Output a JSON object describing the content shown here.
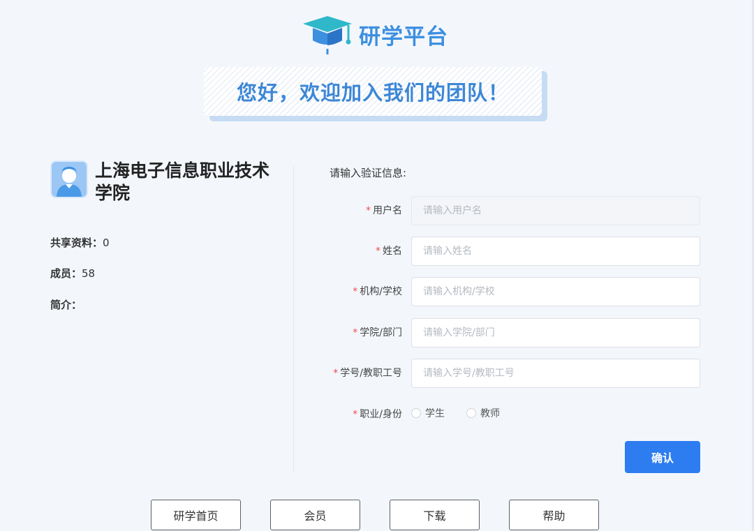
{
  "brand": {
    "name": "研学平台",
    "accent_color": "#3d8fe0",
    "logo_icon": "graduation-cap-icon"
  },
  "banner": {
    "text": "您好，欢迎加入我们的团队！"
  },
  "organization": {
    "name": "上海电子信息职业技术学院",
    "avatar_icon": "user-avatar-icon",
    "shared_label": "共享资料：",
    "shared_value": "0",
    "members_label": "成员：",
    "members_value": "58",
    "intro_label": "简介："
  },
  "form": {
    "title": "请输入验证信息:",
    "required_mark": "*",
    "required_color": "#f04b4b",
    "fields": [
      {
        "label": "用户名",
        "placeholder": "请输入用户名",
        "value": "",
        "disabled": true
      },
      {
        "label": "姓名",
        "placeholder": "请输入姓名",
        "value": ""
      },
      {
        "label": "机构/学校",
        "placeholder": "请输入机构/学校",
        "value": ""
      },
      {
        "label": "学院/部门",
        "placeholder": "请输入学院/部门",
        "value": ""
      },
      {
        "label": "学号/教职工号",
        "placeholder": "请输入学号/教职工号",
        "value": ""
      }
    ],
    "role": {
      "label": "职业/身份",
      "options": [
        "学生",
        "教师"
      ]
    },
    "confirm_label": "确认",
    "confirm_color": "#2d7cf0"
  },
  "footer_nav": [
    "研学首页",
    "会员",
    "下载",
    "帮助"
  ]
}
